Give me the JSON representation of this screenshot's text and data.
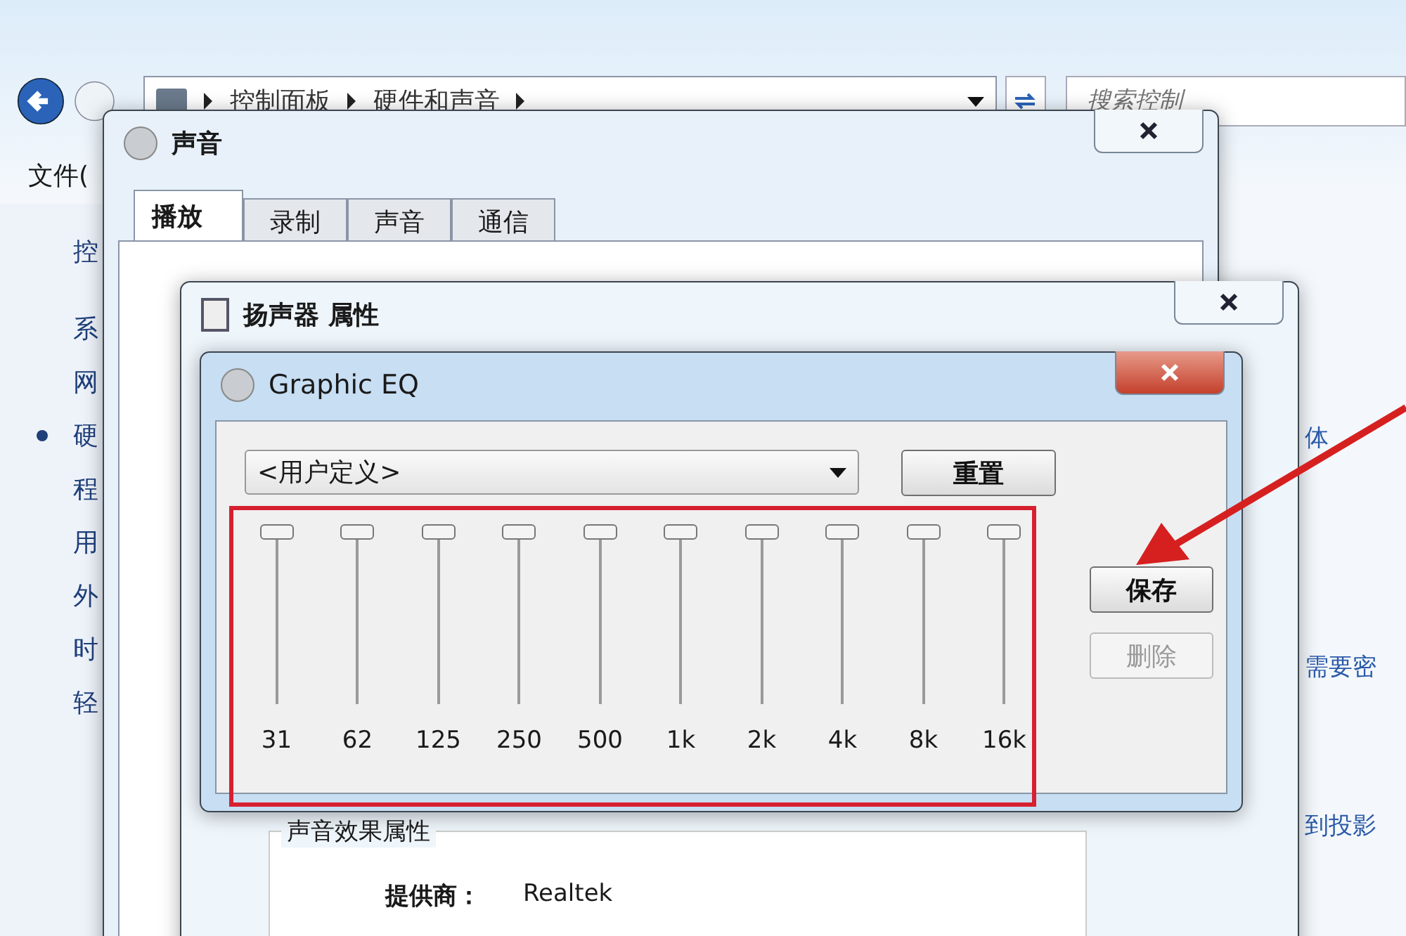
{
  "explorer": {
    "breadcrumb": [
      "控制面板",
      "硬件和声音"
    ],
    "search": {
      "placeholder": "搜索控制"
    },
    "menu": [
      "文件("
    ],
    "sidebar": {
      "items": [
        {
          "label": "控",
          "selected": false
        },
        {
          "label": "系",
          "selected": false
        },
        {
          "label": "网",
          "selected": false
        },
        {
          "label": "硬",
          "selected": true
        },
        {
          "label": "程",
          "selected": false
        },
        {
          "label": "用",
          "selected": false
        },
        {
          "label": "外",
          "selected": false
        },
        {
          "label": "时",
          "selected": false
        },
        {
          "label": "轻",
          "selected": false
        }
      ]
    },
    "links": [
      "体",
      "需要密",
      "到投影"
    ]
  },
  "sound_window": {
    "title": "声音",
    "tabs": [
      {
        "label": "播放",
        "selected": true
      },
      {
        "label": "录制",
        "selected": false
      },
      {
        "label": "声音",
        "selected": false
      },
      {
        "label": "通信",
        "selected": false
      }
    ]
  },
  "speaker_window": {
    "title": "扬声器 属性",
    "group": {
      "title": "声音效果属性",
      "rows": [
        {
          "label": "提供商：",
          "value": "Realtek"
        }
      ]
    }
  },
  "eq_window": {
    "title": "Graphic EQ",
    "preset": "<用户定义>",
    "buttons": [
      {
        "label": "重置",
        "disabled": false
      },
      {
        "label": "保存",
        "disabled": false
      },
      {
        "label": "删除",
        "disabled": true
      }
    ],
    "bands": [
      {
        "label": "31",
        "level": 1
      },
      {
        "label": "62",
        "level": 1
      },
      {
        "label": "125",
        "level": 1
      },
      {
        "label": "250",
        "level": 1
      },
      {
        "label": "500",
        "level": 1
      },
      {
        "label": "1k",
        "level": 1
      },
      {
        "label": "2k",
        "level": 1
      },
      {
        "label": "4k",
        "level": 1
      },
      {
        "label": "8k",
        "level": 1
      },
      {
        "label": "16k",
        "level": 1
      }
    ]
  }
}
